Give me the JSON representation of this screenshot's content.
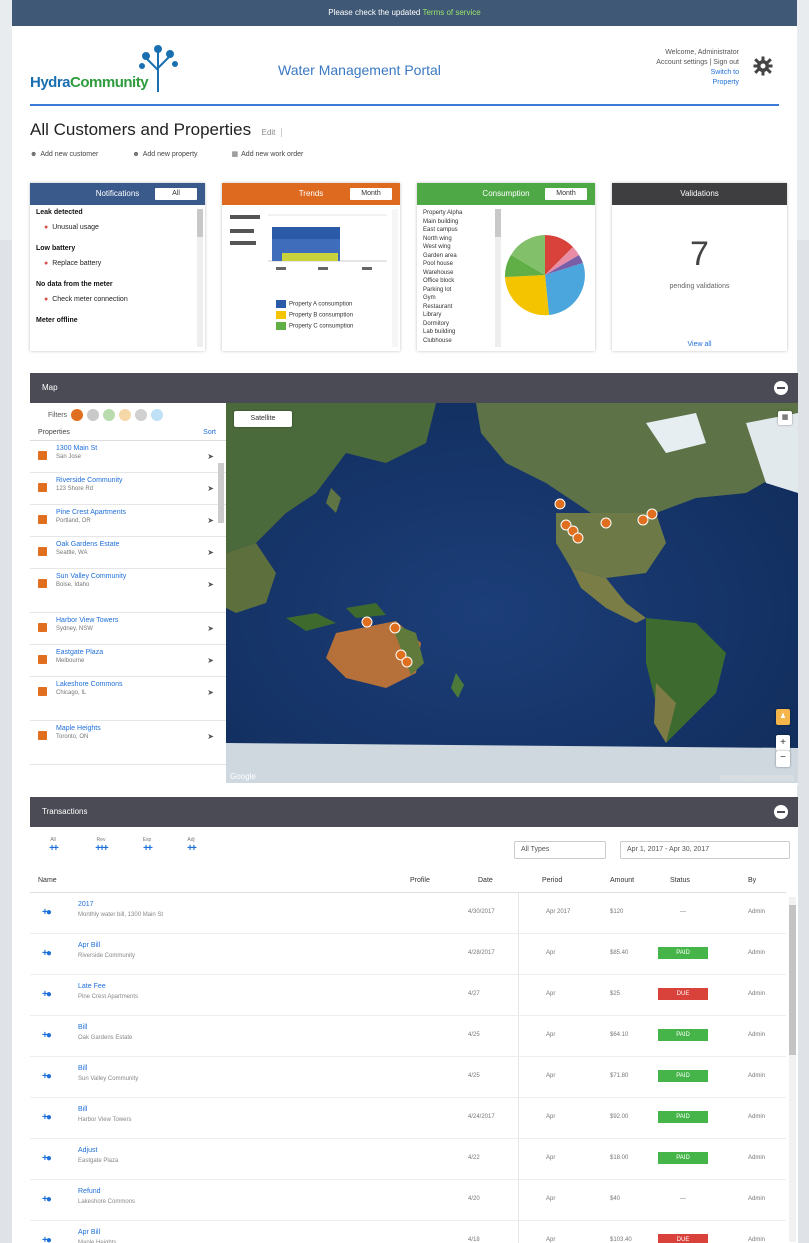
{
  "announcement": {
    "prefix": "Please check the updated",
    "highlight": "Terms of service"
  },
  "header": {
    "logo_a": "Hydra",
    "logo_b": "Community",
    "portal_title": "Water Management Portal",
    "account_line1": "Welcome, Administrator",
    "account_line2": "Account settings | Sign out",
    "account_link": "Switch to",
    "account_link2": "Property"
  },
  "page": {
    "title": "All Customers and Properties",
    "title_tag": "Edit",
    "links": [
      "Add new customer",
      "Add new property",
      "Add new work order"
    ]
  },
  "widgets": {
    "notifications": {
      "title": "Notifications",
      "select": "All",
      "groups": [
        {
          "group": "Leak detected",
          "entry": "Unusual usage"
        },
        {
          "group": "Low battery",
          "entry": "Replace battery"
        },
        {
          "group": "No data from the meter",
          "entry": "Check meter connection"
        },
        {
          "group": "Meter offline",
          "entry": ""
        }
      ]
    },
    "trends": {
      "title": "Trends",
      "select": "Month",
      "legend": [
        "Property A consumption",
        "Property B consumption",
        "Property C consumption"
      ]
    },
    "consumption": {
      "title": "Consumption",
      "select": "Month",
      "items": [
        "Property Alpha",
        "Main building",
        "East campus",
        "North wing",
        "West wing",
        "Garden area",
        "Pool house",
        "Warehouse",
        "Office block",
        "Parking lot",
        "Gym",
        "Restaurant",
        "Library",
        "Dormitory",
        "Lab building",
        "Clubhouse"
      ]
    },
    "validations": {
      "title": "Validations",
      "count": "7",
      "subtitle": "pending validations",
      "link": "View all"
    }
  },
  "map_panel": {
    "title": "Map",
    "filter_label": "Filters",
    "list_header": "Properties",
    "list_sort": "Sort",
    "map_type": "Satellite",
    "properties": [
      {
        "name": "1300 Main St",
        "addr": "San Jose"
      },
      {
        "name": "Riverside Community",
        "addr": "123 Shore Rd"
      },
      {
        "name": "Pine Crest Apartments",
        "addr": "Portland, OR"
      },
      {
        "name": "Oak Gardens Estate",
        "addr": "Seattle, WA"
      },
      {
        "name": "Sun Valley Community",
        "addr": "Boise, Idaho"
      },
      {
        "name": "Harbor View Towers",
        "addr": "Sydney, NSW"
      },
      {
        "name": "Eastgate Plaza",
        "addr": "Melbourne"
      },
      {
        "name": "Lakeshore Commons",
        "addr": "Chicago, IL"
      },
      {
        "name": "Maple Heights",
        "addr": "Toronto, ON"
      }
    ],
    "map_credit": "Map data ©2017 Terms of Use",
    "google_label": "Google"
  },
  "transactions": {
    "title": "Transactions",
    "icons": [
      "All",
      "Rev",
      "Exp",
      "Adj"
    ],
    "filter_type": "All Types",
    "filter_date": "Apr 1, 2017 - Apr 30, 2017",
    "columns": {
      "name": "Name",
      "profile": "Profile",
      "date": "Date",
      "period": "Period",
      "amount": "Amount",
      "status": "Status",
      "by": "By"
    },
    "rows": [
      {
        "name": "2017",
        "sub": "Monthly water bill, 1300 Main St",
        "date": "4/30/2017",
        "period": "Apr 2017",
        "amount": "$120",
        "status": "",
        "by": "Admin"
      },
      {
        "name": "Apr Bill",
        "sub": "Riverside Community",
        "date": "4/28/2017",
        "period": "Apr",
        "amount": "$85.40",
        "status": "PAID",
        "by": "Admin"
      },
      {
        "name": "Late Fee",
        "sub": "Pine Crest Apartments",
        "date": "4/27",
        "period": "Apr",
        "amount": "$25",
        "status": "DUE",
        "by": "Admin"
      },
      {
        "name": "Bill",
        "sub": "Oak Gardens Estate",
        "date": "4/25",
        "period": "Apr",
        "amount": "$64.10",
        "status": "PAID",
        "by": "Admin"
      },
      {
        "name": "Bill",
        "sub": "Sun Valley Community",
        "date": "4/25",
        "period": "Apr",
        "amount": "$71.80",
        "status": "PAID",
        "by": "Admin"
      },
      {
        "name": "Bill",
        "sub": "Harbor View Towers",
        "date": "4/24/2017",
        "period": "Apr",
        "amount": "$92.00",
        "status": "PAID",
        "by": "Admin"
      },
      {
        "name": "Adjust",
        "sub": "Eastgate Plaza",
        "date": "4/22",
        "period": "Apr",
        "amount": "$18.00",
        "status": "PAID",
        "by": "Admin"
      },
      {
        "name": "Refund",
        "sub": "Lakeshore Commons",
        "date": "4/20",
        "period": "Apr",
        "amount": "$40",
        "status": "",
        "by": "Admin"
      },
      {
        "name": "Apr Bill",
        "sub": "Maple Heights",
        "date": "4/18",
        "period": "Apr",
        "amount": "$103.40",
        "status": "DUE",
        "by": "Admin"
      }
    ]
  },
  "colors": {
    "accent": "#3a7bd5",
    "notif": "#3a5a8c",
    "trends": "#dd6a1e",
    "consumption": "#4fa846",
    "validations": "#3e3e40",
    "paid": "#45b549",
    "due": "#d9413b"
  }
}
